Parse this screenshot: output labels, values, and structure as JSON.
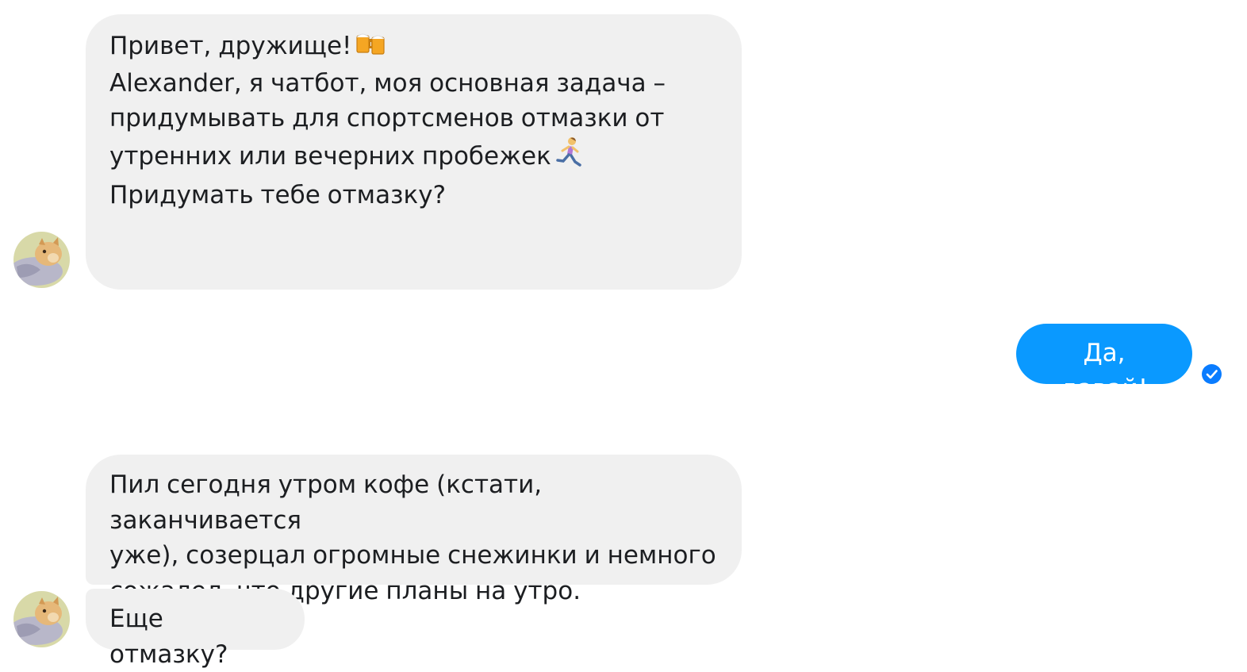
{
  "conversation": {
    "messages": [
      {
        "sender": "bot",
        "paragraphs": [
          "Привет, дружище!",
          "Alexander, я чатбот, моя основная задача –\nпридумывать для спортсменов отмазки от\nутренних или вечерних пробежек",
          "Придумать тебе отмазку?"
        ]
      },
      {
        "sender": "user",
        "text": "Да, давай!"
      },
      {
        "sender": "bot",
        "text": "Пил сегодня утром кофе (кстати, заканчивается\nуже), созерцал огромные снежинки и немного\nсожалел, что другие планы на утро."
      },
      {
        "sender": "bot",
        "text": "Еще отмазку?"
      }
    ]
  },
  "icons": {
    "greeting_emoji": "clinking-beer-mugs",
    "running_emoji": "woman-running",
    "seen_indicator": "check-circle",
    "avatar": "dog-avatar"
  },
  "colors": {
    "incoming_bubble": "#f0f0f0",
    "outgoing_bubble": "#0a99ff",
    "seen_indicator": "#0a7cff"
  }
}
